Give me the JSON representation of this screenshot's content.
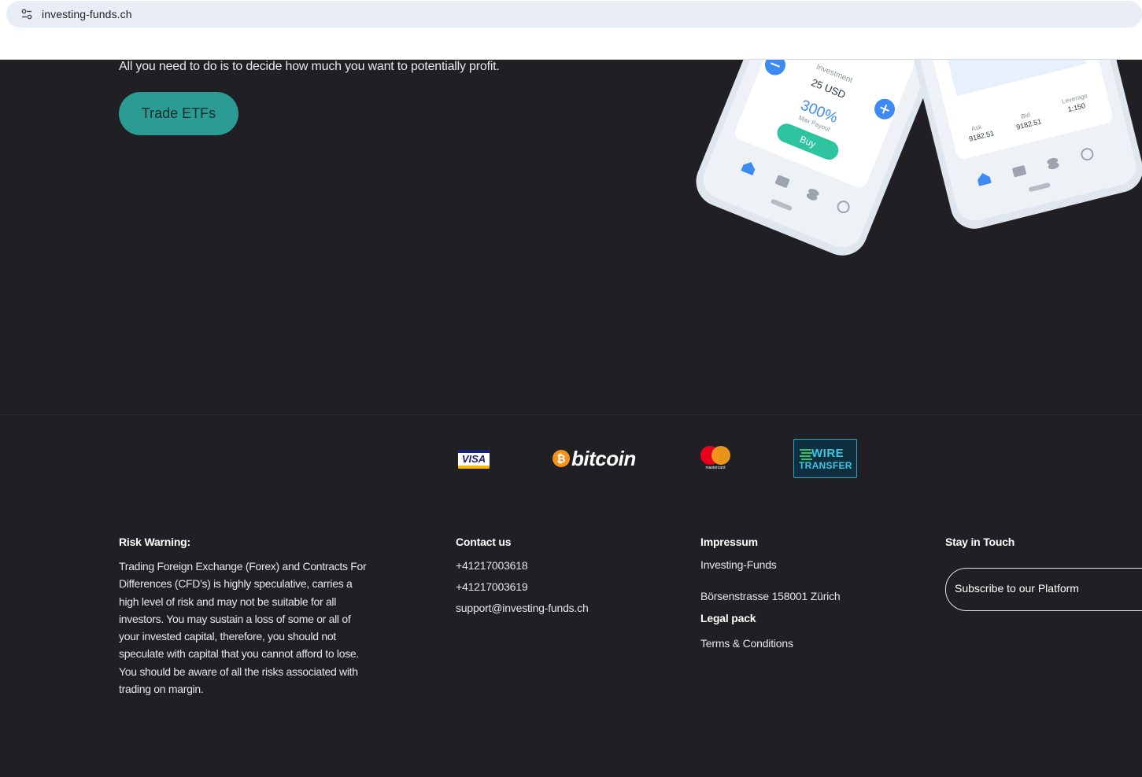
{
  "browser": {
    "url": "investing-funds.ch",
    "site_info_icon": "tune-icon"
  },
  "hero": {
    "subtitle": "All you need to do is to decide how much you want to potentially profit.",
    "cta_label": "Trade ETFs"
  },
  "phone_mockup": {
    "investment_label": "Investment",
    "investment_value": "25 USD",
    "payout_percent": "300%",
    "payout_label": "Max Payout",
    "buy_label": "Buy",
    "ask_label": "Ask",
    "ask_value": "9182.51",
    "bid_label": "Bid",
    "bid_value": "9182.51",
    "leverage_label": "Leverage",
    "leverage_value": "1:150"
  },
  "payments": {
    "visa": "VISA",
    "bitcoin": "bitcoin",
    "bitcoin_symbol": "₿",
    "mastercard": "mastercard",
    "wire_line1": "WIRE",
    "wire_line2": "TRANSFER",
    "colors": {
      "visa_blue": "#1a1f71",
      "visa_gold": "#f7b600",
      "btc_orange": "#f7931a",
      "mc_red": "#eb001b",
      "mc_yellow": "#f79e1b",
      "wire_cyan": "#3cc6e6"
    }
  },
  "footer": {
    "risk": {
      "heading": "Risk Warning:",
      "body": "Trading Foreign Exchange (Forex) and Contracts For Differences (CFD's) is highly speculative, carries a high level of risk and may not be suitable for all investors. You may sustain a loss of some or all of your invested capital, therefore, you should not speculate with capital that you cannot afford to lose. You should be aware of all the risks associated with trading on margin."
    },
    "contact": {
      "heading": "Contact us",
      "phone1": "+41217003618",
      "phone2": "+41217003619",
      "email": "support@investing-funds.ch"
    },
    "impressum": {
      "heading": "Impressum",
      "company": "Investing-Funds",
      "address": "Börsenstrasse 158001 Zürich",
      "legal_heading": "Legal pack",
      "terms": "Terms & Conditions"
    },
    "touch": {
      "heading": "Stay in Touch",
      "subscribe_placeholder": "Subscribe to our Platform"
    }
  },
  "colors": {
    "page_bg": "#202024",
    "accent_teal": "#2b9c93",
    "text": "#e6e6ea"
  }
}
